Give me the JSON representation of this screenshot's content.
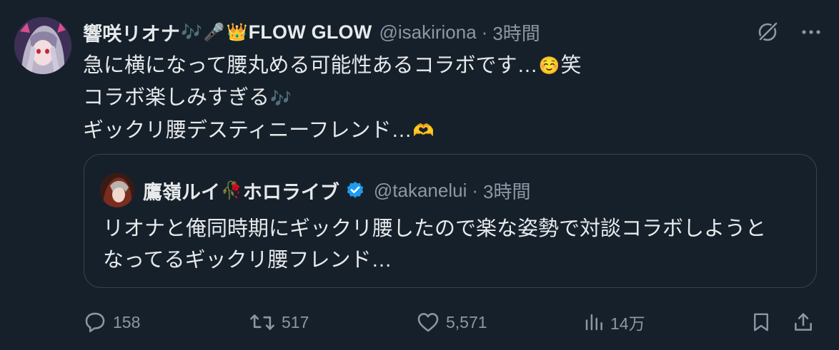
{
  "tweet": {
    "display_name": "響咲リオナ",
    "name_emojis": [
      "🎶",
      "🎤",
      "👑"
    ],
    "name_suffix": "FLOW GLOW",
    "handle": "@isakiriona",
    "separator": "·",
    "time": "3時間",
    "avatar_icon": "avatar-image",
    "more_icon": "more-horizontal-icon",
    "grok_icon": "grok-slash-icon",
    "body": {
      "line1": "急に横になって腰丸める可能性あるコラボです…",
      "line1_emoji": "☺️",
      "line1_tail": "笑",
      "line2": "コラボ楽しみすぎる",
      "line2_emoji": "🎶",
      "line3": "ギックリ腰デスティニーフレンド…",
      "line3_emoji": "🫶"
    }
  },
  "quote": {
    "display_name": "鷹嶺ルイ",
    "name_emoji": "🥀",
    "name_suffix": "ホロライブ",
    "verified_icon": "verified-badge-icon",
    "handle": "@takanelui",
    "separator": "·",
    "time": "3時間",
    "text_line1": "リオナと俺同時期にギックリ腰したので楽な姿勢で対談コラボしようと",
    "text_line2": "なってるギックリ腰フレンド…"
  },
  "actions": {
    "reply_count": "158",
    "retweet_count": "517",
    "like_count": "5,571",
    "views_count": "14万"
  },
  "colors": {
    "background": "#15202b",
    "text": "#e7e9ea",
    "muted": "#8b98a5",
    "border": "#38444d",
    "verified": "#1d9bf0"
  }
}
